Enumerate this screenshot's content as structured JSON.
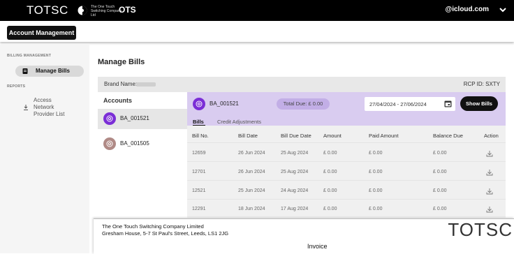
{
  "topbar": {
    "logo_text": "TOTSC",
    "logo_tagline": "The One Touch Switching Company Ltd",
    "app_name": "OTS",
    "account_email": "@icloud.com"
  },
  "subnav": {
    "account_management": "Account Management"
  },
  "sidebar": {
    "billing_section": "BILLING MANAGEMENT",
    "manage_bills": "Manage Bills",
    "reports_section": "REPORTS",
    "access_network_line1": "Access",
    "access_network_line2": "Network",
    "access_network_line3": "Provider List"
  },
  "main": {
    "title": "Manage Bills",
    "brand_label": "Brand Name:",
    "rcp_id": "RCP ID: SXTY"
  },
  "accounts": {
    "header": "Accounts",
    "items": [
      {
        "label": "BA_001521",
        "color": "#7b2ed6"
      },
      {
        "label": "BA_001505",
        "color": "#b08a86"
      }
    ]
  },
  "detail": {
    "selected_account": "BA_001521",
    "total_due": "Total Due: £ 0.00",
    "date_range": "27/04/2024 - 27/06/2024",
    "show_bills": "Show Bills",
    "tabs": [
      "Bills",
      "Credit Adjustments"
    ],
    "columns": [
      "Bill No.",
      "Bill Date",
      "Bill Due Date",
      "Amount",
      "Paid Amount",
      "Balance Due",
      "Action"
    ],
    "rows": [
      [
        "12659",
        "26 Jun 2024",
        "25 Aug 2024",
        "£ 0.00",
        "£ 0.00",
        "£ 0.00"
      ],
      [
        "12701",
        "26 Jun 2024",
        "25 Aug 2024",
        "£ 0.00",
        "£ 0.00",
        "£ 0.00"
      ],
      [
        "12521",
        "25 Jun 2024",
        "24 Aug 2024",
        "£ 0.00",
        "£ 0.00",
        "£ 0.00"
      ],
      [
        "12291",
        "18 Jun 2024",
        "17 Aug 2024",
        "£ 0.00",
        "£ 0.00",
        "£ 0.00"
      ]
    ]
  },
  "invoice": {
    "company_line": "The One Touch Switching Company Limited",
    "address_line": "Gresham House, 5-7 St Paul's Street, Leeds, LS1 2JG",
    "title": "Invoice",
    "logo_text": "TOTSC"
  },
  "icons": {
    "logo_mark": "toggle-circle-icon",
    "chevron": "chevron-down-icon",
    "manage_bills": "document-icon",
    "access_network": "download-icon",
    "account": "at-sign-icon",
    "calendar": "calendar-icon",
    "action": "download-icon"
  }
}
